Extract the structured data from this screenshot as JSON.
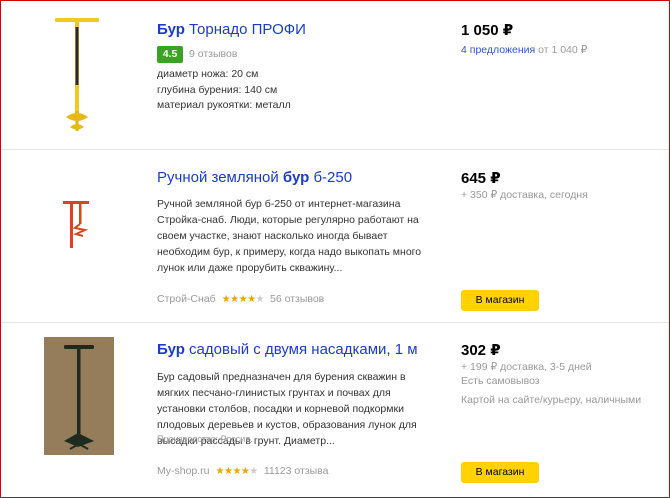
{
  "items": [
    {
      "title_bold": "Бур",
      "title_rest": " Торнадо ПРОФИ",
      "rating": "4.5",
      "reviews": "9 отзывов",
      "specs": [
        "диаметр ножа: 20 см",
        "глубина бурения: 140 см",
        "материал рукоятки: металл"
      ],
      "price": "1 050 ₽",
      "offers_link": "4 предложения",
      "offers_from": " от 1 040 ₽"
    },
    {
      "title_pre": "Ручной земляной ",
      "title_bold": "бур",
      "title_post": " б-250",
      "description": "Ручной земляной бур б-250 от интернет-магазина Стройка-снаб. Люди, которые регулярно работают на своем участке, знают насколько иногда бывает необходим бур, к примеру, когда надо выкопать много лунок или даже прорубить скважину...",
      "shop": "Строй-Снаб",
      "stars": 4,
      "reviews": "56 отзывов",
      "price": "645 ₽",
      "delivery": "+ 350 ₽ доставка, сегодня",
      "button": "В магазин"
    },
    {
      "title_bold": "Бур",
      "title_rest": " садовый с двумя насадками, 1 м",
      "description": "Бур садовый предназначен для бурения скважин в мягких песчано-глинистых грунтах и почвах для установки столбов, посадки и корневой подкормки плодовых деревьев и кустов, образования лунок для высадки рассады в грунт. Диаметр...",
      "origin": "Производство: Россия.",
      "shop": "My-shop.ru",
      "stars": 4,
      "reviews": "11123 отзыва",
      "price": "302 ₽",
      "delivery": "+ 199 ₽ доставка, 3-5 дней",
      "pickup": "Есть самовывоз",
      "payment": "Картой на сайте/курьеру, наличными",
      "button": "В магазин"
    }
  ],
  "colors": {
    "link": "#1a3dc1",
    "rating_green": "#3aa324",
    "button_yellow": "#ffd200",
    "star": "#f2a400",
    "frame": "#d40000"
  }
}
